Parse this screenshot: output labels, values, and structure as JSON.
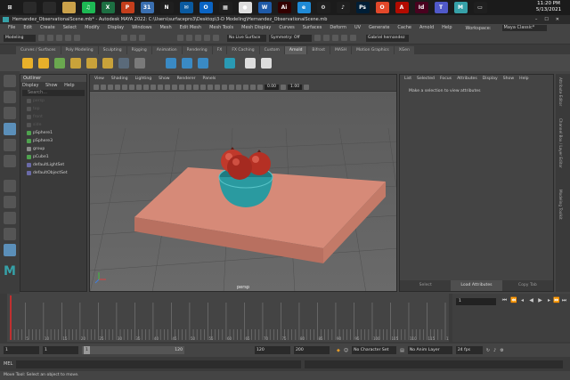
{
  "taskbar": {
    "apps": [
      {
        "name": "chrome-app-icon",
        "label": "",
        "color": "#2a2a2a"
      },
      {
        "name": "edge-app-icon",
        "label": "",
        "color": "#2a2a2a"
      },
      {
        "name": "folder-app-icon",
        "label": "",
        "color": "#caa14a"
      },
      {
        "name": "spotify-app-icon",
        "label": "♫",
        "color": "#1db954"
      },
      {
        "name": "excel-app-icon",
        "label": "X",
        "color": "#1d6f42"
      },
      {
        "name": "powerpoint-app-icon",
        "label": "P",
        "color": "#c43e1c"
      },
      {
        "name": "calendar-app-icon",
        "label": "31",
        "color": "#3a6fb0"
      },
      {
        "name": "netflix-app-icon",
        "label": "N",
        "color": "#1f1f1f"
      },
      {
        "name": "mail-app-icon",
        "label": "✉",
        "color": "#0a5aa0"
      },
      {
        "name": "outlook-app-icon",
        "label": "O",
        "color": "#0a64c4"
      },
      {
        "name": "store-app-icon",
        "label": "▦",
        "color": "#1f1f1f"
      },
      {
        "name": "chrome2-app-icon",
        "label": "●",
        "color": "#dddddd"
      },
      {
        "name": "word-app-icon",
        "label": "W",
        "color": "#1e5aa8"
      },
      {
        "name": "illustrator-app-icon",
        "label": "Ai",
        "color": "#330000"
      },
      {
        "name": "edge2-app-icon",
        "label": "e",
        "color": "#1f8ad6"
      },
      {
        "name": "settings-app-icon",
        "label": "⚙",
        "color": "#1f1f1f"
      },
      {
        "name": "music-app-icon",
        "label": "♪",
        "color": "#1f1f1f"
      },
      {
        "name": "photoshop-app-icon",
        "label": "Ps",
        "color": "#001e36"
      },
      {
        "name": "office-app-icon",
        "label": "O",
        "color": "#e3482a"
      },
      {
        "name": "acrobat-app-icon",
        "label": "A",
        "color": "#b30b00"
      },
      {
        "name": "indesign-app-icon",
        "label": "Id",
        "color": "#49021f"
      },
      {
        "name": "teams-app-icon",
        "label": "T",
        "color": "#5059c9"
      },
      {
        "name": "maya-app-icon",
        "label": "M",
        "color": "#36a1a8"
      },
      {
        "name": "sticky-app-icon",
        "label": "▭",
        "color": "#1f1f1f"
      }
    ],
    "time": "11:20 PM",
    "date": "5/13/2021"
  },
  "window": {
    "title": "Hernandez_ObservationalScene.mb* - Autodesk MAYA 2022: C:\\Users\\surfacepro3\\Desktop\\3-D Modeling\\Hernandez_ObservationalScene.mb"
  },
  "menubar": {
    "items": [
      "File",
      "Edit",
      "Create",
      "Select",
      "Modify",
      "Display",
      "Windows",
      "Mesh",
      "Edit Mesh",
      "Mesh Tools",
      "Mesh Display",
      "Curves",
      "Surfaces",
      "Deform",
      "UV",
      "Generate",
      "Cache",
      "Arnold",
      "Help"
    ],
    "workspace_label": "Workspace:",
    "workspace_value": "Maya Classic*"
  },
  "statusline": {
    "mode": "Modeling",
    "live_surface": "No Live Surface",
    "symmetry": "Symmetry: Off",
    "user": "Gabriel hernandez"
  },
  "shelf": {
    "tabs": [
      "Curves / Surfaces",
      "Poly Modeling",
      "Sculpting",
      "Rigging",
      "Animation",
      "Rendering",
      "FX",
      "FX Caching",
      "Custom",
      "Arnold",
      "Bifrost",
      "MASH",
      "Motion Graphics",
      "XGen"
    ],
    "active_tab": "Arnold"
  },
  "outliner": {
    "title": "Outliner",
    "menu": [
      "Display",
      "Show",
      "Help"
    ],
    "search_placeholder": "Search...",
    "items": [
      {
        "label": "persp",
        "dim": true,
        "color": "#555"
      },
      {
        "label": "top",
        "dim": true,
        "color": "#555"
      },
      {
        "label": "front",
        "dim": true,
        "color": "#555"
      },
      {
        "label": "side",
        "dim": true,
        "color": "#555"
      },
      {
        "label": "pSphere1",
        "dim": false,
        "color": "#4fa34f"
      },
      {
        "label": "pSphere3",
        "dim": false,
        "color": "#4fa34f"
      },
      {
        "label": "group",
        "dim": false,
        "color": "#8a8a8a"
      },
      {
        "label": "pCube1",
        "dim": false,
        "color": "#4fa34f"
      },
      {
        "label": "defaultLightSet",
        "dim": false,
        "color": "#6a6aa8"
      },
      {
        "label": "defaultObjectSet",
        "dim": false,
        "color": "#6a6aa8"
      }
    ]
  },
  "viewport": {
    "menu": [
      "View",
      "Shading",
      "Lighting",
      "Show",
      "Renderer",
      "Panels"
    ],
    "value1": "0.00",
    "value2": "1.00",
    "camera_label": "persp"
  },
  "attribute_editor": {
    "menu": [
      "List",
      "Selected",
      "Focus",
      "Attributes",
      "Display",
      "Show",
      "Help"
    ],
    "message": "Make a selection to view attributes",
    "buttons": [
      "Select",
      "Load Attributes",
      "Copy Tab"
    ],
    "side_tabs": [
      "Attribute Editor",
      "Channel Box / Layer Editor",
      "Modeling Toolkit"
    ]
  },
  "timeline": {
    "current_frame": "1",
    "ticks": [
      "5",
      "10",
      "15",
      "20",
      "25",
      "30",
      "35",
      "40",
      "45",
      "50",
      "55",
      "60",
      "65",
      "70",
      "75",
      "80",
      "85",
      "90",
      "95",
      "100",
      "105",
      "110",
      "115",
      "120"
    ]
  },
  "range": {
    "start": "1",
    "start2": "1",
    "range_end": "120",
    "end1": "120",
    "end2": "200",
    "character_set": "No Character Set",
    "anim_layer": "No Anim Layer",
    "fps": "24 fps"
  },
  "command": {
    "lang": "MEL"
  },
  "help_line": "Move Tool: Select an object to move."
}
